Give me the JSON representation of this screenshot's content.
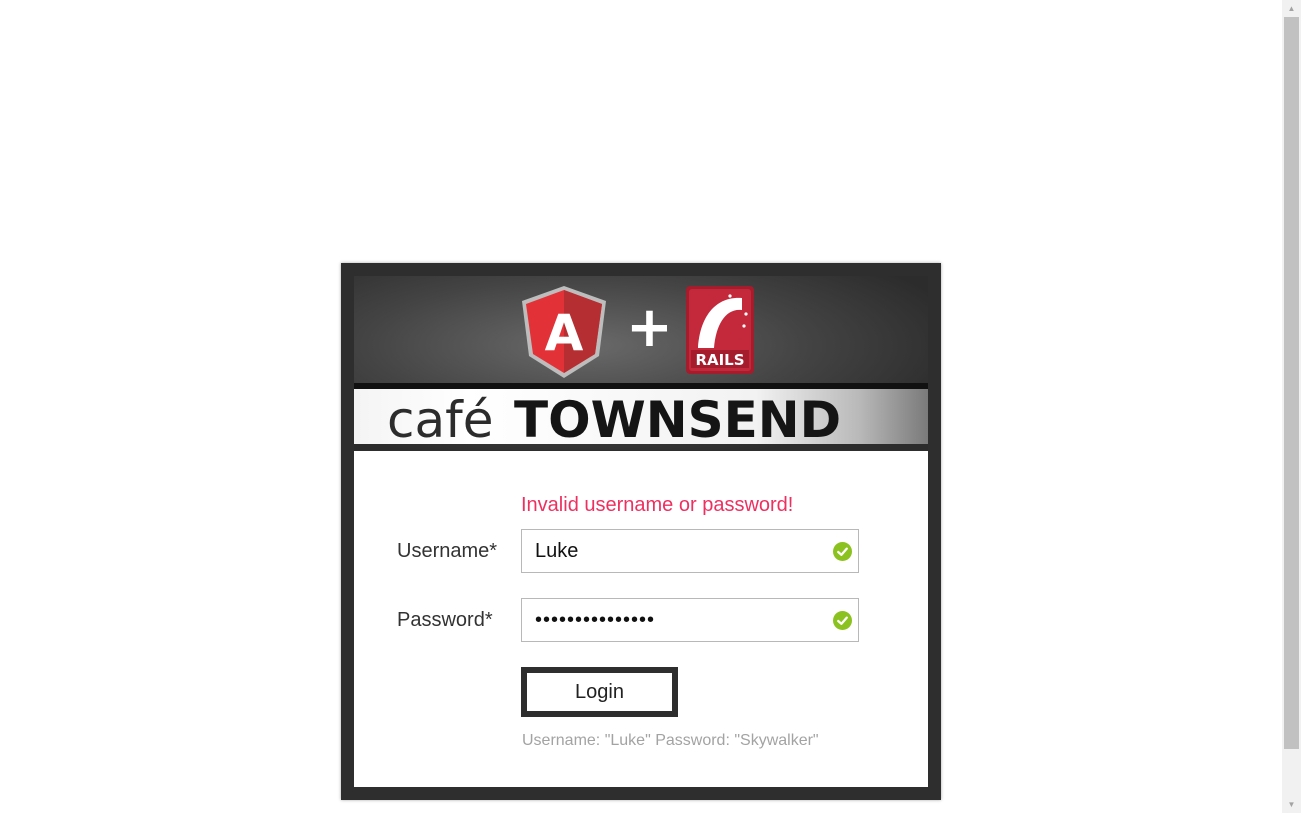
{
  "banner": {
    "angular_logo_text": "A",
    "plus": "+",
    "rails_logo_text": "RAILS",
    "brand_cafe": "café",
    "brand_townsend": "TOWNSEND"
  },
  "login": {
    "error_message": "Invalid username or password!",
    "username_label": "Username*",
    "username_value": "Luke",
    "password_label": "Password*",
    "password_value": "•••••••••••••••",
    "login_button": "Login",
    "hint": "Username: \"Luke\" Password: \"Skywalker\""
  },
  "colors": {
    "error": "#ee3060",
    "valid": "#8cc21f",
    "frame": "#2e2e2e"
  },
  "icons": {
    "valid": "check-circle-icon",
    "scroll_up": "triangle-up-icon",
    "scroll_down": "triangle-down-icon"
  }
}
